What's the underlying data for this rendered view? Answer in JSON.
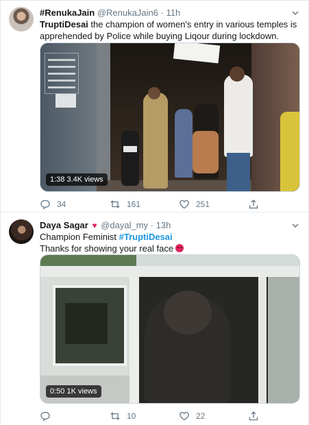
{
  "tweets": [
    {
      "name": "#RenukaJain",
      "handle": "@RenukaJain6",
      "separator": "·",
      "time": "11h",
      "text_prefix": "TruptiDesai",
      "text_rest": " the champion of women's entry in various temples is apprehended by Police while buying Liqour during lockdown.",
      "video_duration": "1:38",
      "video_views": "3.4K views",
      "replies": "34",
      "retweets": "161",
      "likes": "251"
    },
    {
      "name": "Daya Sagar",
      "name_emoji": "♥",
      "handle": "@dayal_my",
      "separator": "·",
      "time": "13h",
      "text_line1_prefix": "Champion Feminist ",
      "text_line1_hashtag": "#TruptiDesai",
      "text_line2": "Thanks for showing your real face",
      "video_duration": "0:50",
      "video_views": "1K views",
      "replies": "",
      "retweets": "10",
      "likes": "22"
    }
  ],
  "colors": {
    "link": "#1b95e0",
    "secondary_text": "#657786",
    "primary_text": "#14171a",
    "heart": "#e0245e"
  },
  "icons": {
    "reply": "reply-icon",
    "retweet": "retweet-icon",
    "like": "heart-icon",
    "share": "share-icon",
    "more": "chevron-down-icon"
  }
}
